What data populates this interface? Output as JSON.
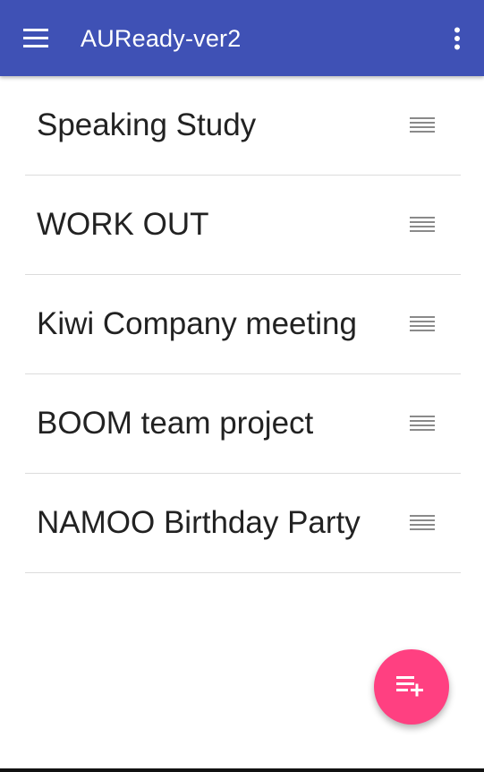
{
  "app": {
    "title": "AUReady-ver2",
    "colors": {
      "primary": "#3f51b5",
      "accent": "#ff4081",
      "divider": "#dcdcdc",
      "text": "#222222"
    }
  },
  "appbar": {
    "menu_icon": "hamburger-menu-icon",
    "overflow_icon": "more-vert-icon"
  },
  "list": {
    "items": [
      {
        "label": "Speaking Study",
        "handle_icon": "reorder-icon"
      },
      {
        "label": "WORK OUT",
        "handle_icon": "reorder-icon"
      },
      {
        "label": "Kiwi Company meeting",
        "handle_icon": "reorder-icon"
      },
      {
        "label": "BOOM team project",
        "handle_icon": "reorder-icon"
      },
      {
        "label": "NAMOO Birthday Party",
        "handle_icon": "reorder-icon"
      }
    ]
  },
  "fab": {
    "icon": "playlist-add-icon"
  }
}
